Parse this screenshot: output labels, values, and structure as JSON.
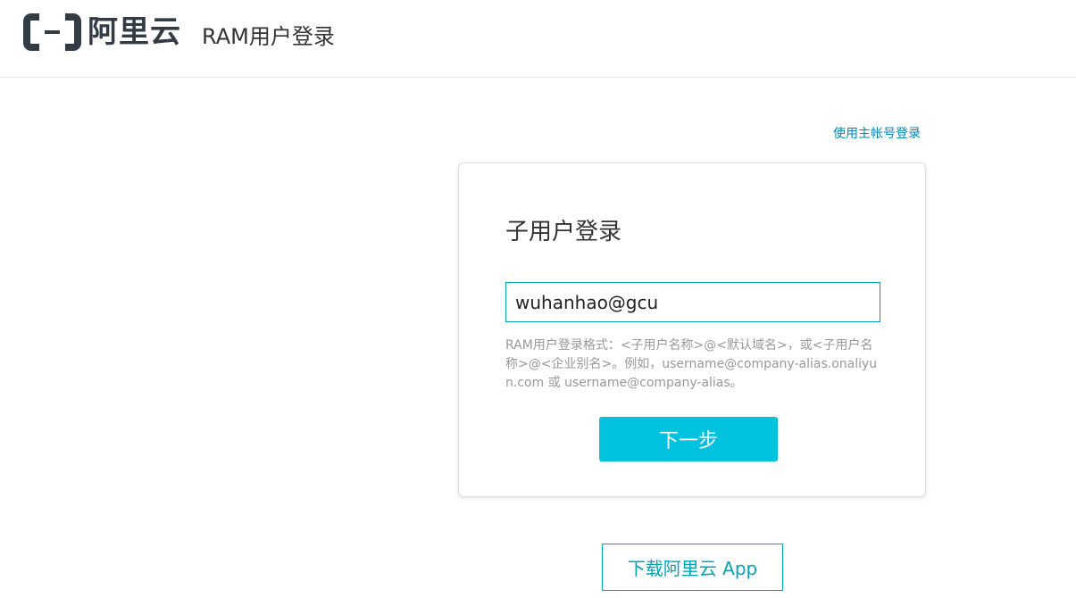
{
  "header": {
    "logo_text": "阿里云",
    "title": "RAM用户登录"
  },
  "switch_link": "使用主帐号登录",
  "card": {
    "title": "子用户登录",
    "username_value": "wuhanhao@gcu",
    "hint": "RAM用户登录格式：<子用户名称>@<默认域名>，或<子用户名称>@<企业别名>。例如，username@company-alias.onaliyun.com 或 username@company-alias。",
    "next_button": "下一步"
  },
  "app_button": "下载阿里云 App",
  "colors": {
    "accent": "#00c1de",
    "link": "#0088b3",
    "brand_dark": "#333b45"
  }
}
